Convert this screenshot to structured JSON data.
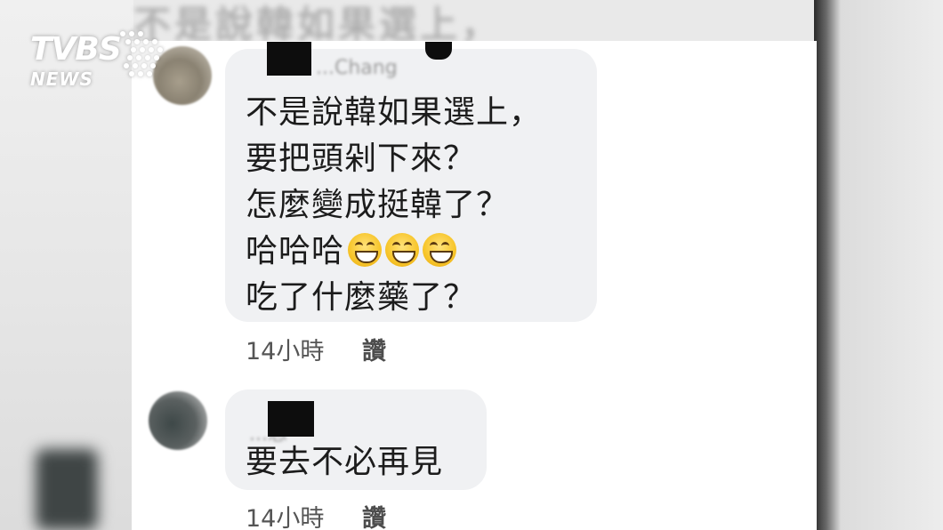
{
  "background_blur_text": "不是說韓如果選上，",
  "logo": {
    "main": "TVBS",
    "sub": "NEWS"
  },
  "comments": [
    {
      "name_ghost": "...Chang",
      "lines": [
        "不是說韓如果選上，",
        "要把頭剁下來？",
        "怎麼變成挺韓了？",
        "哈哈哈",
        "吃了什麼藥了？"
      ],
      "emoji": [
        "grinning-face-icon",
        "grinning-face-icon",
        "grinning-face-icon"
      ],
      "time": "14小時",
      "like_label": "讚"
    },
    {
      "name_ghost": "...忠",
      "lines": [
        "要去不必再見"
      ],
      "time": "14小時",
      "like_label": "讚"
    }
  ]
}
